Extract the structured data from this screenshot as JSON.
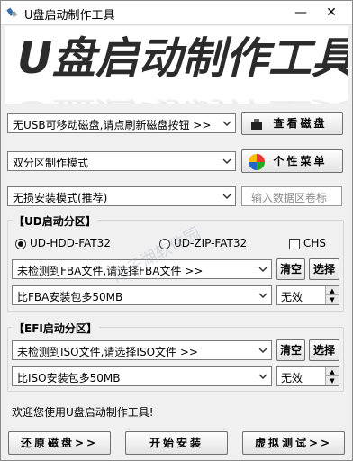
{
  "window": {
    "title": "U盘启动制作工具",
    "minimize": "—",
    "close": "✕"
  },
  "banner": {
    "text": "U盘启动制作工具"
  },
  "disk_select": {
    "value": "无USB可移动磁盘,请点刷新磁盘按钮 >>"
  },
  "view_disk_button": "查看磁盘",
  "partition_mode": {
    "value": "双分区制作模式"
  },
  "personal_menu_button": "个性菜单",
  "install_mode": {
    "value": "无损安装模式(推荐)"
  },
  "volume_label": {
    "placeholder": "输入数据区卷标"
  },
  "ud_group": {
    "title": "【UD启动分区】",
    "radio_hdd": "UD-HDD-FAT32",
    "radio_zip": "UD-ZIP-FAT32",
    "chs": "CHS",
    "fba_select": "未检测到FBA文件,请选择FBA文件 >>",
    "clear": "清空",
    "choose": "选择",
    "size_select": "比FBA安装包多50MB",
    "spin_value": "无效"
  },
  "efi_group": {
    "title": "【EFI启动分区】",
    "iso_select": "未检测到ISO文件,请选择ISO文件 >>",
    "clear": "清空",
    "choose": "选择",
    "size_select": "比ISO安装包多50MB",
    "spin_value": "无效"
  },
  "status_text": "欢迎您使用U盘启动制作工具!",
  "bottom": {
    "restore": "还原磁盘>>",
    "start": "开始安装",
    "simulate": "虚拟测试>>"
  },
  "watermark": {
    "text": "阳子湖软件园"
  },
  "colors": {
    "banner_text": "#2b2b2b",
    "group_border": "#d6d6d6",
    "window_bg": "#f0f0f0"
  }
}
